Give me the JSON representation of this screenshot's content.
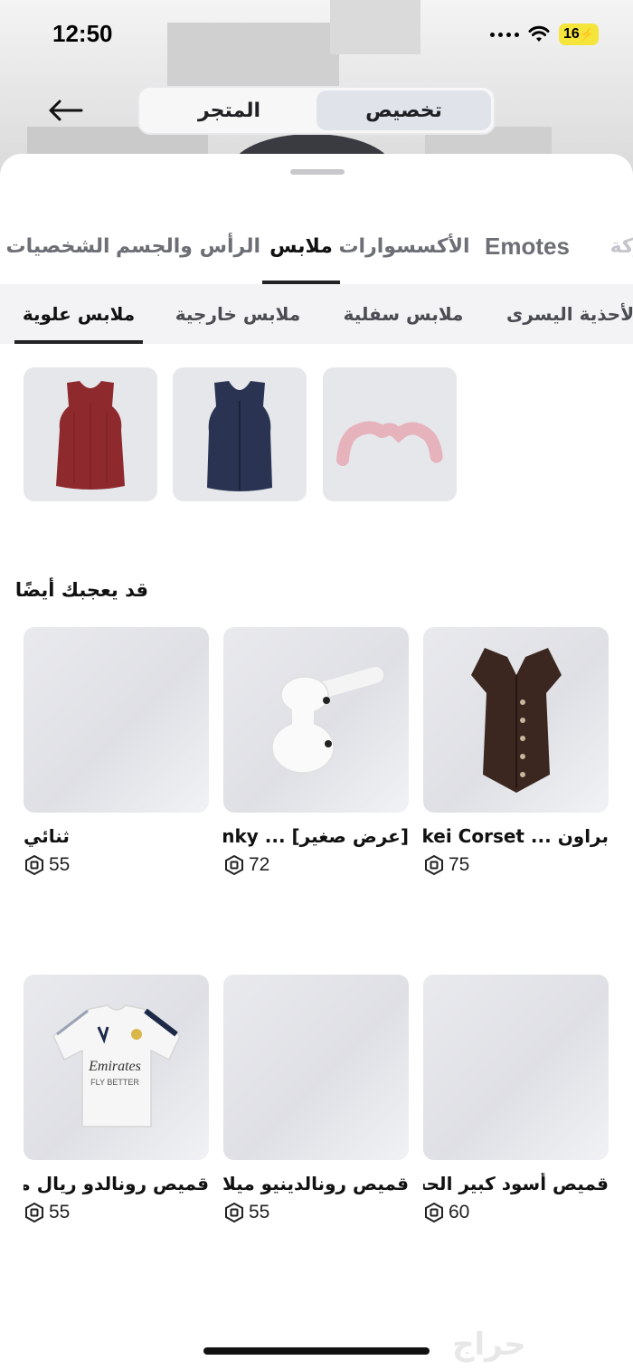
{
  "status_bar": {
    "time": "12:50",
    "battery": "16"
  },
  "header": {
    "segments": [
      {
        "label": "تخصيص",
        "active": true
      },
      {
        "label": "المتجر",
        "active": false
      }
    ]
  },
  "main_tabs": [
    {
      "label": "ركة"
    },
    {
      "label": "Emotes"
    },
    {
      "label": "الأكسسوارات"
    },
    {
      "label": "ملابس",
      "active": true
    },
    {
      "label": "الرأس والجسم"
    },
    {
      "label": "الشخصيات"
    }
  ],
  "sub_tabs": [
    {
      "label": "الأحذية اليسرى"
    },
    {
      "label": "ملابس سفلية"
    },
    {
      "label": "ملابس خارجية"
    },
    {
      "label": "ملابس علوية",
      "active": true
    }
  ],
  "owned_items": [
    {
      "icon": "red-tank-top",
      "color": "#8e2a2e"
    },
    {
      "icon": "navy-vest",
      "color": "#2a3352"
    },
    {
      "icon": "pink-ruffle-sleeves",
      "color": "#e6b3bd"
    }
  ],
  "recommended": {
    "title": "قد يعجبك أيضًا",
    "items": [
      {
        "name": "براون ... Vkei Corset",
        "price": "75",
        "thumb": "brown-corset"
      },
      {
        "name": "[عرض صغير] ... Binky",
        "price": "72",
        "thumb": "white-pacifier"
      },
      {
        "name": "ثنائي",
        "price": "55",
        "thumb": "blank"
      },
      {
        "name": "قميص أسود كبير الحجم",
        "price": "60",
        "thumb": "blank"
      },
      {
        "name": "قميص رونالدينيو ميلان...",
        "price": "55",
        "thumb": "blank"
      },
      {
        "name": "قميص رونالدو ريال مدر...",
        "price": "55",
        "thumb": "real-madrid-shirt"
      }
    ]
  },
  "watermark": "حراج",
  "colors": {
    "accent": "#222222",
    "card_bg": "#e6e7eb",
    "battery": "#f5e43a"
  }
}
